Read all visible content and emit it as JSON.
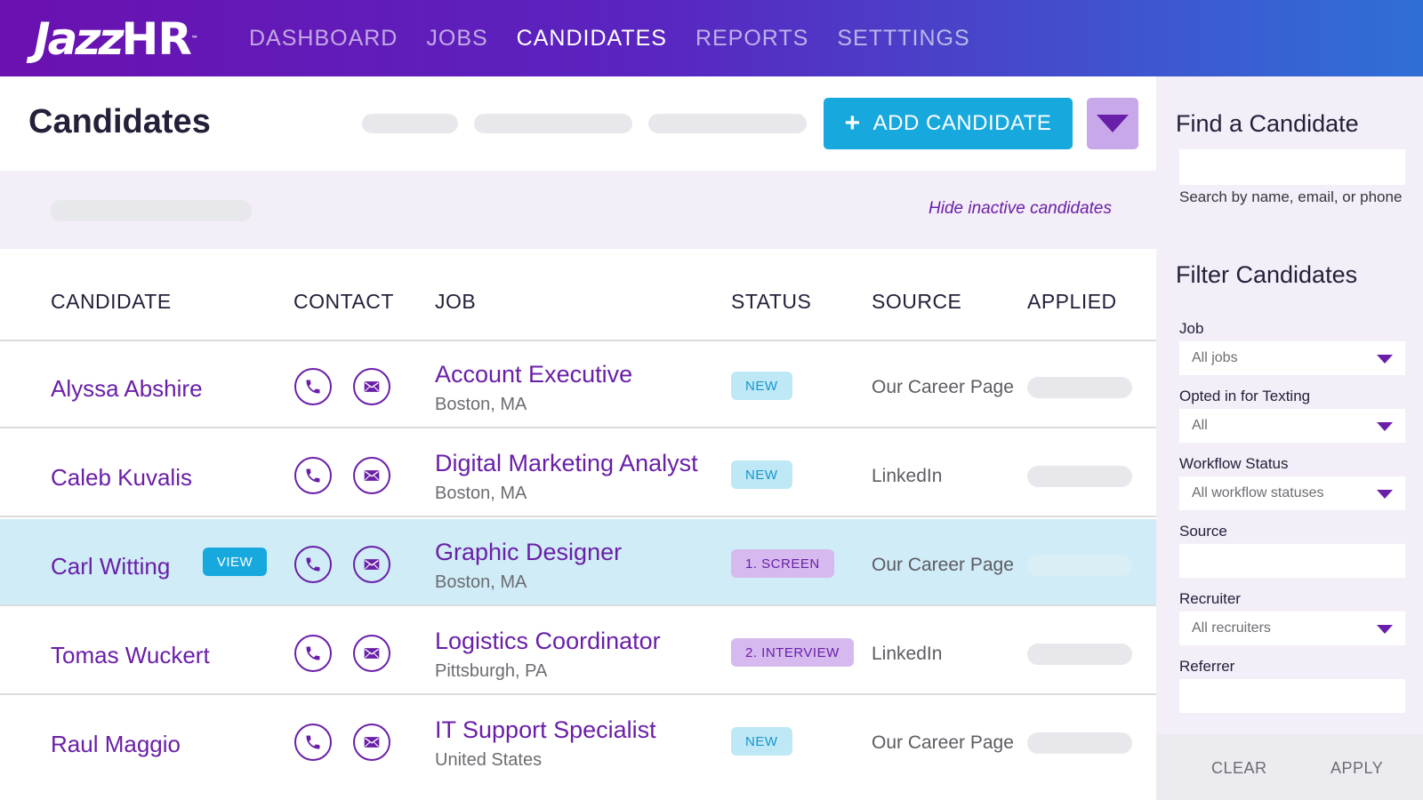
{
  "brand": {
    "name": "Jazz",
    "suffix": "HR",
    "tm": "™"
  },
  "nav": [
    {
      "label": "DASHBOARD",
      "active": false
    },
    {
      "label": "JOBS",
      "active": false
    },
    {
      "label": "CANDIDATES",
      "active": true
    },
    {
      "label": "REPORTS",
      "active": false
    },
    {
      "label": "SETTTINGS",
      "active": false
    }
  ],
  "page": {
    "title": "Candidates",
    "add_button": "ADD CANDIDATE",
    "add_icon": "+",
    "hide_inactive": "Hide inactive candidates"
  },
  "table": {
    "headers": {
      "candidate": "CANDIDATE",
      "contact": "CONTACT",
      "job": "JOB",
      "status": "STATUS",
      "source": "SOURCE",
      "applied": "APPLIED"
    },
    "view_label": "VIEW",
    "rows": [
      {
        "name": "Alyssa Abshire",
        "job": "Account Executive",
        "location": "Boston, MA",
        "status": "NEW",
        "source": "Our Career Page",
        "selected": false
      },
      {
        "name": "Caleb Kuvalis",
        "job": "Digital Marketing Analyst",
        "location": "Boston, MA",
        "status": "NEW",
        "source": "LinkedIn",
        "selected": false
      },
      {
        "name": "Carl Witting",
        "job": "Graphic Designer",
        "location": "Boston, MA",
        "status": "1. SCREEN",
        "source": "Our Career Page",
        "selected": true
      },
      {
        "name": "Tomas Wuckert",
        "job": "Logistics Coordinator",
        "location": "Pittsburgh, PA",
        "status": "2. INTERVIEW",
        "source": "LinkedIn",
        "selected": false
      },
      {
        "name": "Raul Maggio",
        "job": "IT Support Specialist",
        "location": "United States",
        "status": "NEW",
        "source": "Our Career Page",
        "selected": false
      }
    ]
  },
  "sidebar": {
    "find_title": "Find a Candidate",
    "search_hint": "Search by name, email, or phone",
    "filter_title": "Filter Candidates",
    "filters": {
      "job_label": "Job",
      "job_value": "All jobs",
      "texting_label": "Opted in for Texting",
      "texting_value": "All",
      "workflow_label": "Workflow Status",
      "workflow_value": "All workflow statuses",
      "source_label": "Source",
      "recruiter_label": "Recruiter",
      "recruiter_value": "All recruiters",
      "referrer_label": "Referrer"
    },
    "clear": "CLEAR",
    "apply": "APPLY"
  },
  "colors": {
    "brand_purple": "#6a1fa8",
    "accent_blue": "#17a8de",
    "selected_row": "#cfecf7",
    "panel_bg": "#f3eef8"
  },
  "icons": [
    "phone-icon",
    "mail-icon",
    "chevron-down-icon",
    "plus-icon"
  ]
}
